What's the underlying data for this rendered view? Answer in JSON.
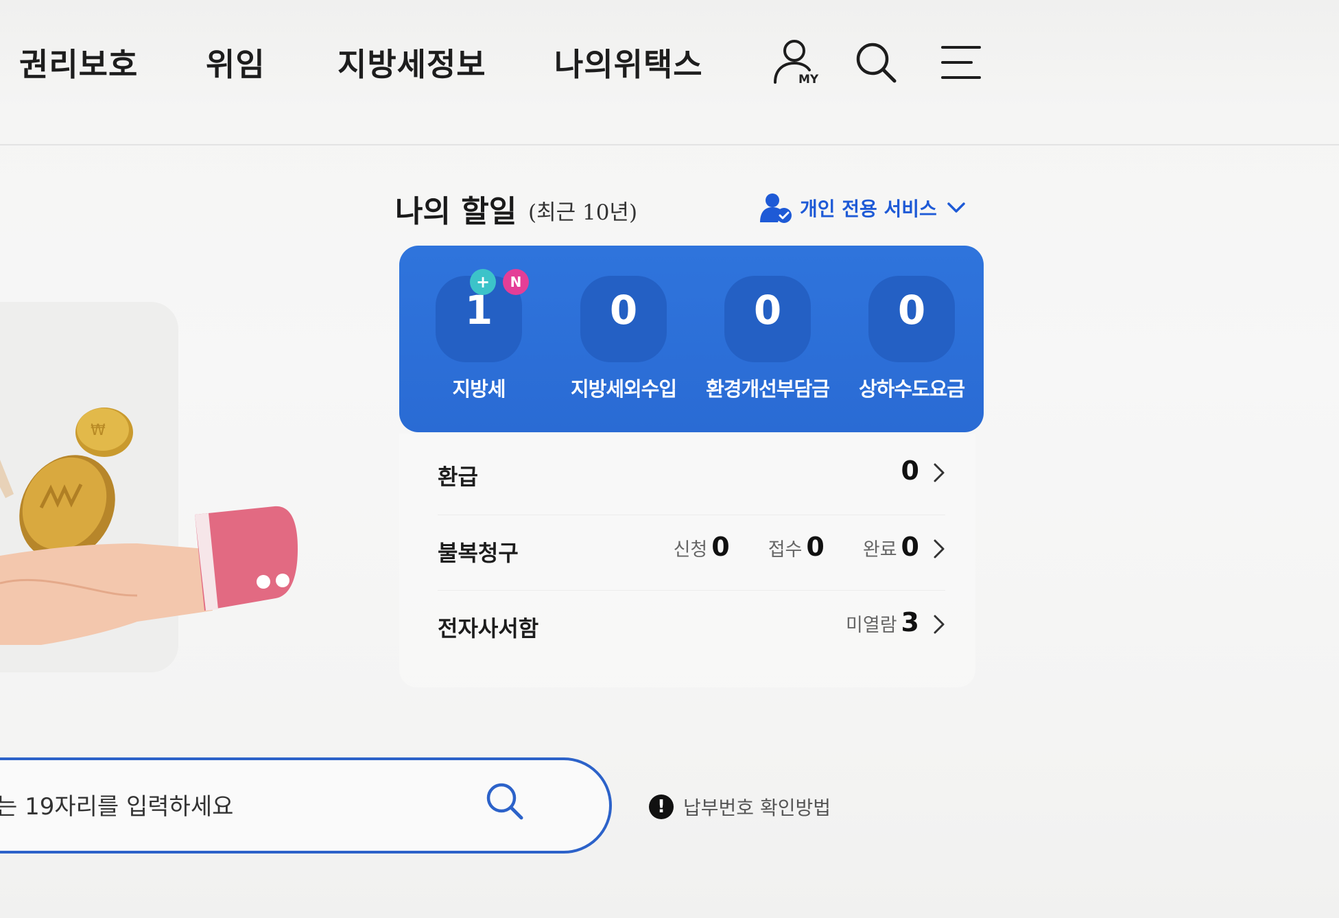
{
  "nav": {
    "items": [
      {
        "label": "권리보호"
      },
      {
        "label": "위임"
      },
      {
        "label": "지방세정보"
      },
      {
        "label": "나의위택스"
      }
    ],
    "my_label": "MY",
    "icons": [
      "my-page-icon",
      "search-icon",
      "menu-icon"
    ]
  },
  "todo": {
    "title": "나의 할일",
    "subtitle": "(최근 10년)",
    "personal_service": "개인 전용 서비스",
    "counts": [
      {
        "value": "1",
        "label": "지방세",
        "badges": [
          "+",
          "N"
        ]
      },
      {
        "value": "0",
        "label": "지방세외수입"
      },
      {
        "value": "0",
        "label": "환경개선부담금"
      },
      {
        "value": "0",
        "label": "상하수도요금"
      }
    ],
    "rows": {
      "refund": {
        "title": "환급",
        "value": "0"
      },
      "appeal": {
        "title": "불복청구",
        "applied_label": "신청",
        "applied_value": "0",
        "received_label": "접수",
        "received_value": "0",
        "done_label": "완료",
        "done_value": "0"
      },
      "mailbox": {
        "title": "전자사서함",
        "unread_label": "미열람",
        "unread_value": "3"
      }
    }
  },
  "search": {
    "placeholder": "는 19자리를 입력하세요"
  },
  "help": {
    "icon_text": "!",
    "label": "납부번호 확인방법"
  },
  "colors": {
    "accent_blue": "#2f74dc",
    "badge_plus": "#3cc3c9",
    "badge_new": "#e43e97",
    "link_blue": "#1e5ad6"
  }
}
